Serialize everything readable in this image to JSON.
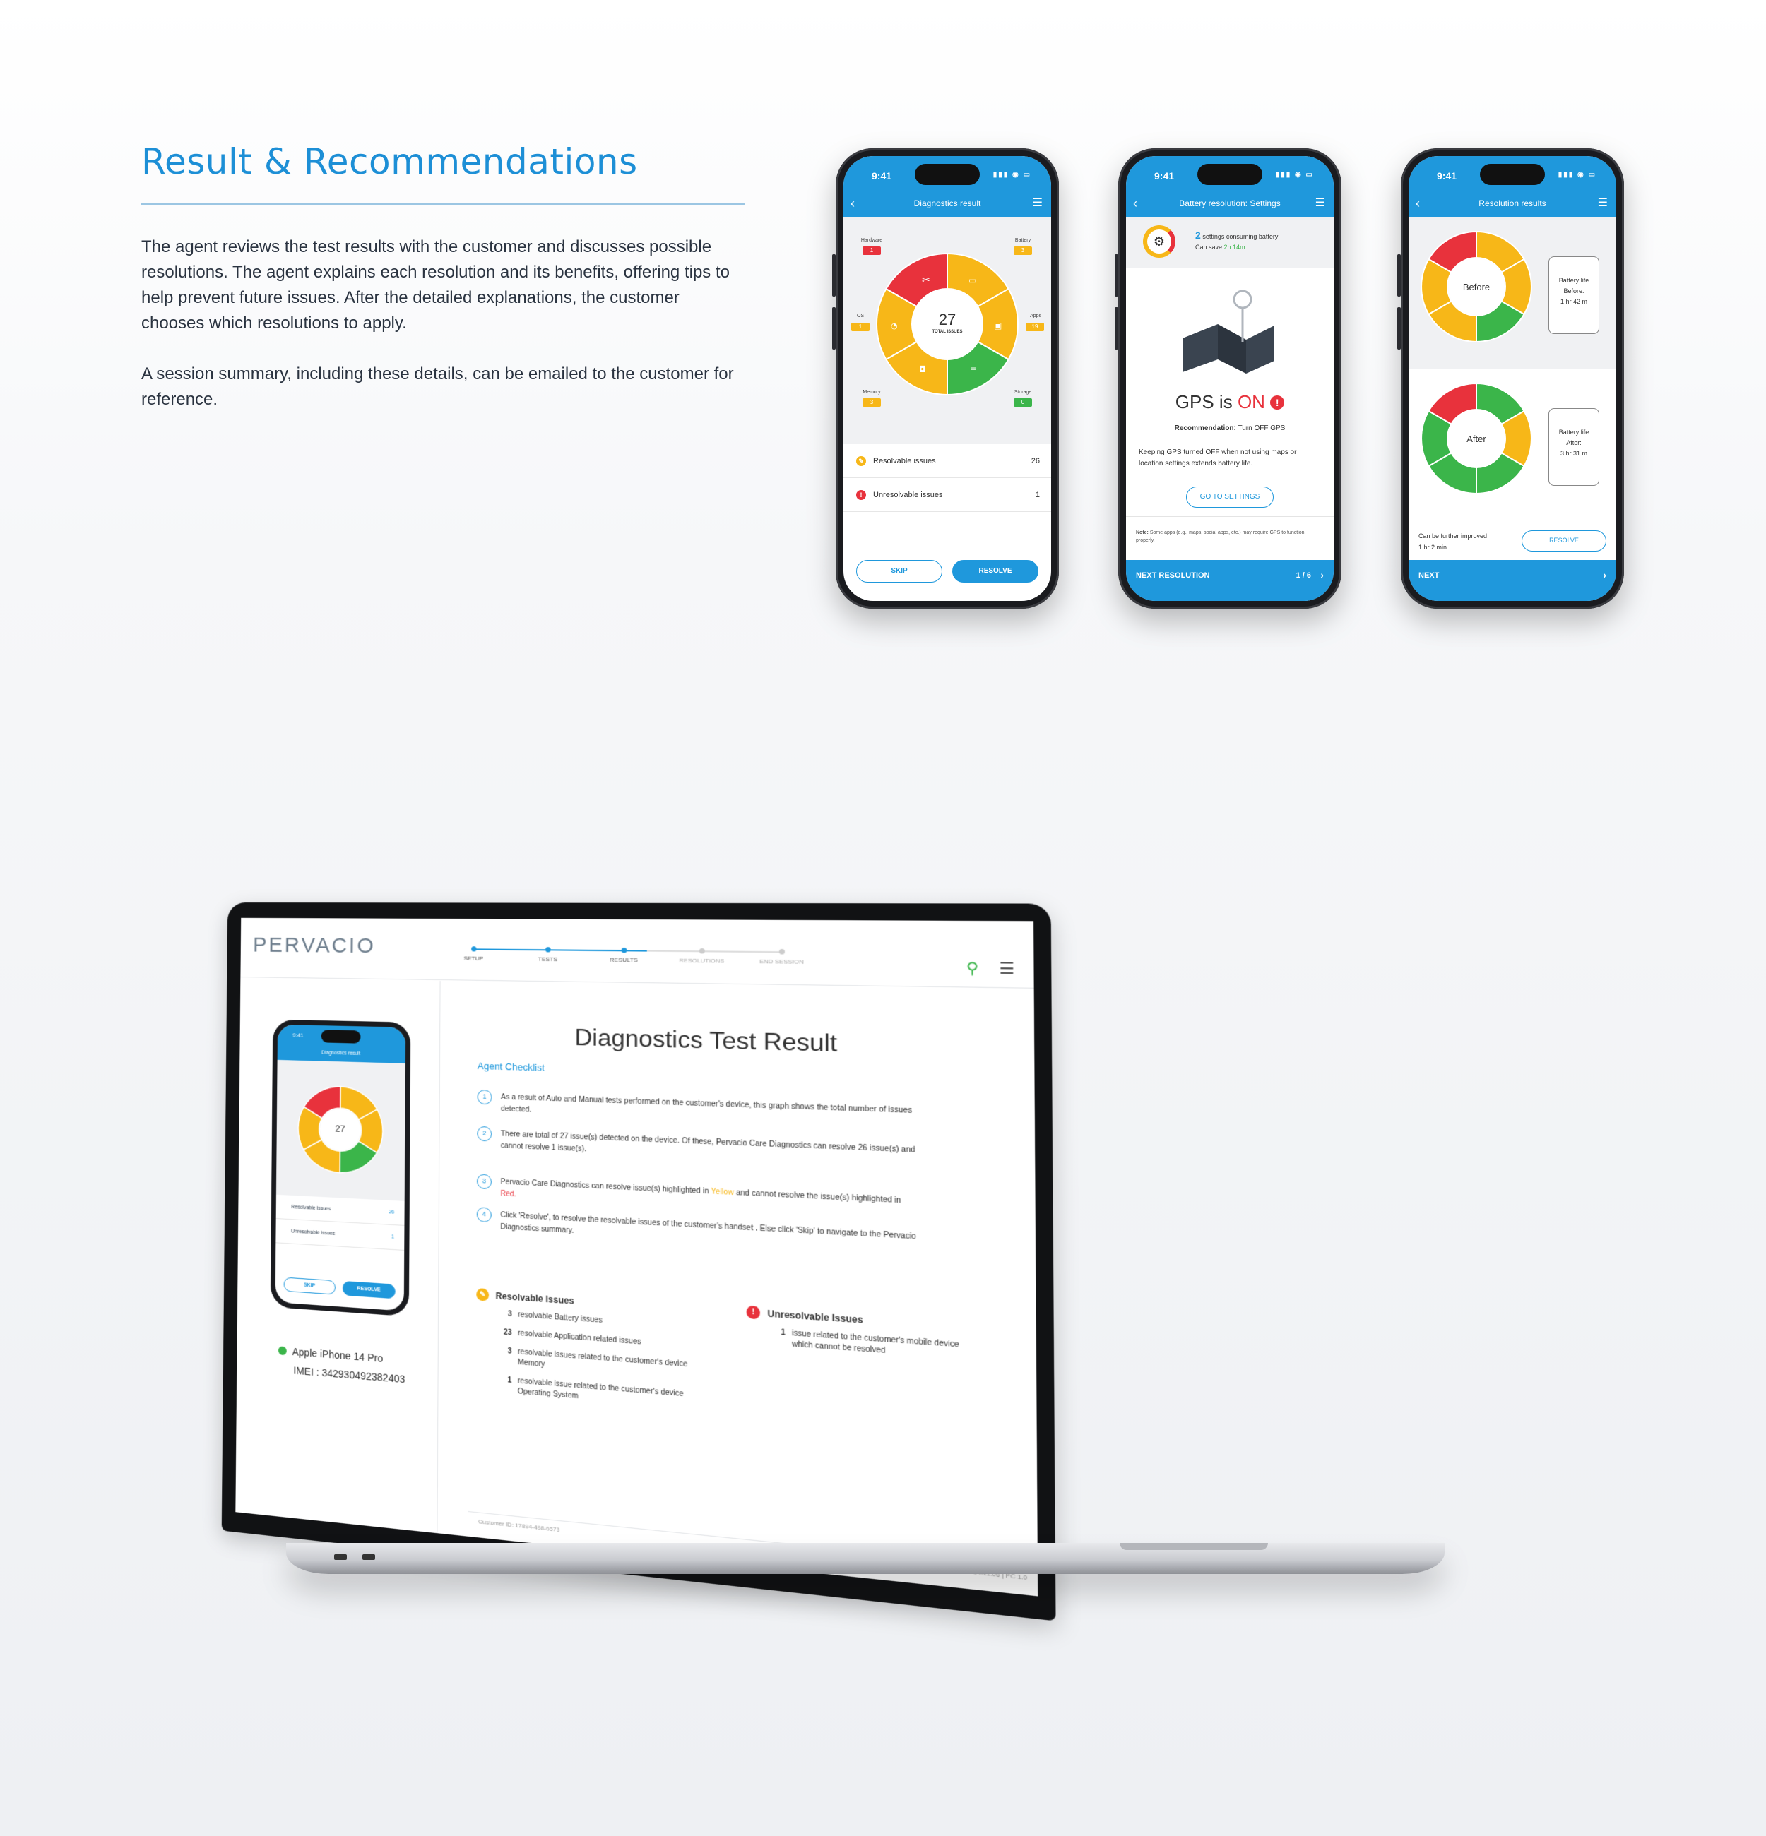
{
  "hero": {
    "title": "Result & Recommendations",
    "p1": "The agent reviews the test results with the customer and discusses possible resolutions. The agent explains each resolution and its benefits, offering tips to help prevent future issues. After the detailed explanations, the customer chooses which resolutions to apply.",
    "p2": "A session summary, including these details, can be emailed to the customer for reference."
  },
  "colors": {
    "brand": "#1f98dc",
    "red": "#e8323c",
    "yellow": "#f7b718",
    "green": "#3bb54a"
  },
  "phone1": {
    "time": "9:41",
    "title": "Diagnostics result",
    "total": "27",
    "total_label": "TOTAL ISSUES",
    "categories": [
      {
        "name": "Hardware",
        "count": "1",
        "status": "red"
      },
      {
        "name": "Battery",
        "count": "3",
        "status": "yellow"
      },
      {
        "name": "OS",
        "count": "1",
        "status": "yellow"
      },
      {
        "name": "Apps",
        "count": "19",
        "status": "yellow"
      },
      {
        "name": "Memory",
        "count": "3",
        "status": "yellow"
      },
      {
        "name": "Storage",
        "count": "0",
        "status": "green"
      }
    ],
    "rows": [
      {
        "label": "Resolvable issues",
        "count": "26"
      },
      {
        "label": "Unresolvable issues",
        "count": "1"
      }
    ],
    "skip": "SKIP",
    "resolve": "RESOLVE"
  },
  "phone2": {
    "time": "9:41",
    "title": "Battery resolution: Settings",
    "settings_count": "2",
    "settings_text": "settings consuming battery",
    "can_save": "Can save",
    "save_value": "2h 14m",
    "gps_prefix": "GPS is",
    "gps_state": "ON",
    "rec_label": "Recommendation:",
    "rec_value": "Turn OFF GPS",
    "description": "Keeping GPS turned OFF when not using maps or location settings extends battery life.",
    "cta": "GO TO SETTINGS",
    "note_label": "Note:",
    "note": "Some apps (e.g., maps, social apps, etc.) may require GPS to function properly.",
    "next": "NEXT RESOLUTION",
    "pager": "1 / 6"
  },
  "phone3": {
    "time": "9:41",
    "title": "Resolution results",
    "before_label": "Before",
    "after_label": "After",
    "before_card": [
      "Battery life",
      "Before:",
      "1 hr 42 m"
    ],
    "after_card": [
      "Battery life",
      "After:",
      "3 hr 31 m"
    ],
    "improve_text": "Can be further improved",
    "improve_value": "1 hr 2 min",
    "resolve": "RESOLVE",
    "next": "NEXT"
  },
  "laptop": {
    "logo": "PERVACIO",
    "steps": [
      "SETUP",
      "TESTS",
      "RESULTS",
      "RESOLUTIONS",
      "END SESSION"
    ],
    "title": "Diagnostics Test Result",
    "checklist_title": "Agent Checklist",
    "checks": [
      "As a result of Auto and Manual tests performed on the customer's device, this graph shows the total number of issues detected.",
      "There are total of 27 issue(s) detected on the device. Of these, Pervacio Care Diagnostics can resolve 26 issue(s) and cannot resolve 1 issue(s).",
      "Pervacio Care Diagnostics can resolve issue(s) highlighted in",
      "Click 'Resolve', to resolve the resolvable issues of the customer's handset . Else click 'Skip' to navigate to the Pervacio Diagnostics summary."
    ],
    "check3_yellow": "Yellow",
    "check3_mid": "and cannot resolve the issue(s) highlighted in",
    "check3_red": "Red.",
    "resolvable_title": "Resolvable Issues",
    "resolvable": [
      {
        "n": "3",
        "text": "resolvable Battery issues"
      },
      {
        "n": "23",
        "text": "resolvable Application related issues"
      },
      {
        "n": "3",
        "text": "resolvable issues related to the customer's device Memory"
      },
      {
        "n": "1",
        "text": "resolvable issue related to the customer's device Operating System"
      }
    ],
    "unresolvable_title": "Unresolvable Issues",
    "unresolvable": [
      {
        "n": "1",
        "text": "issue related to the customer's mobile device which cannot be resolved"
      }
    ],
    "device_name": "Apple iPhone 14 Pro",
    "imei": "IMEI : 342930492382403",
    "customer_id": "Customer ID: 17894-498-6573",
    "version": "04.11.06 | PC 1.0"
  }
}
